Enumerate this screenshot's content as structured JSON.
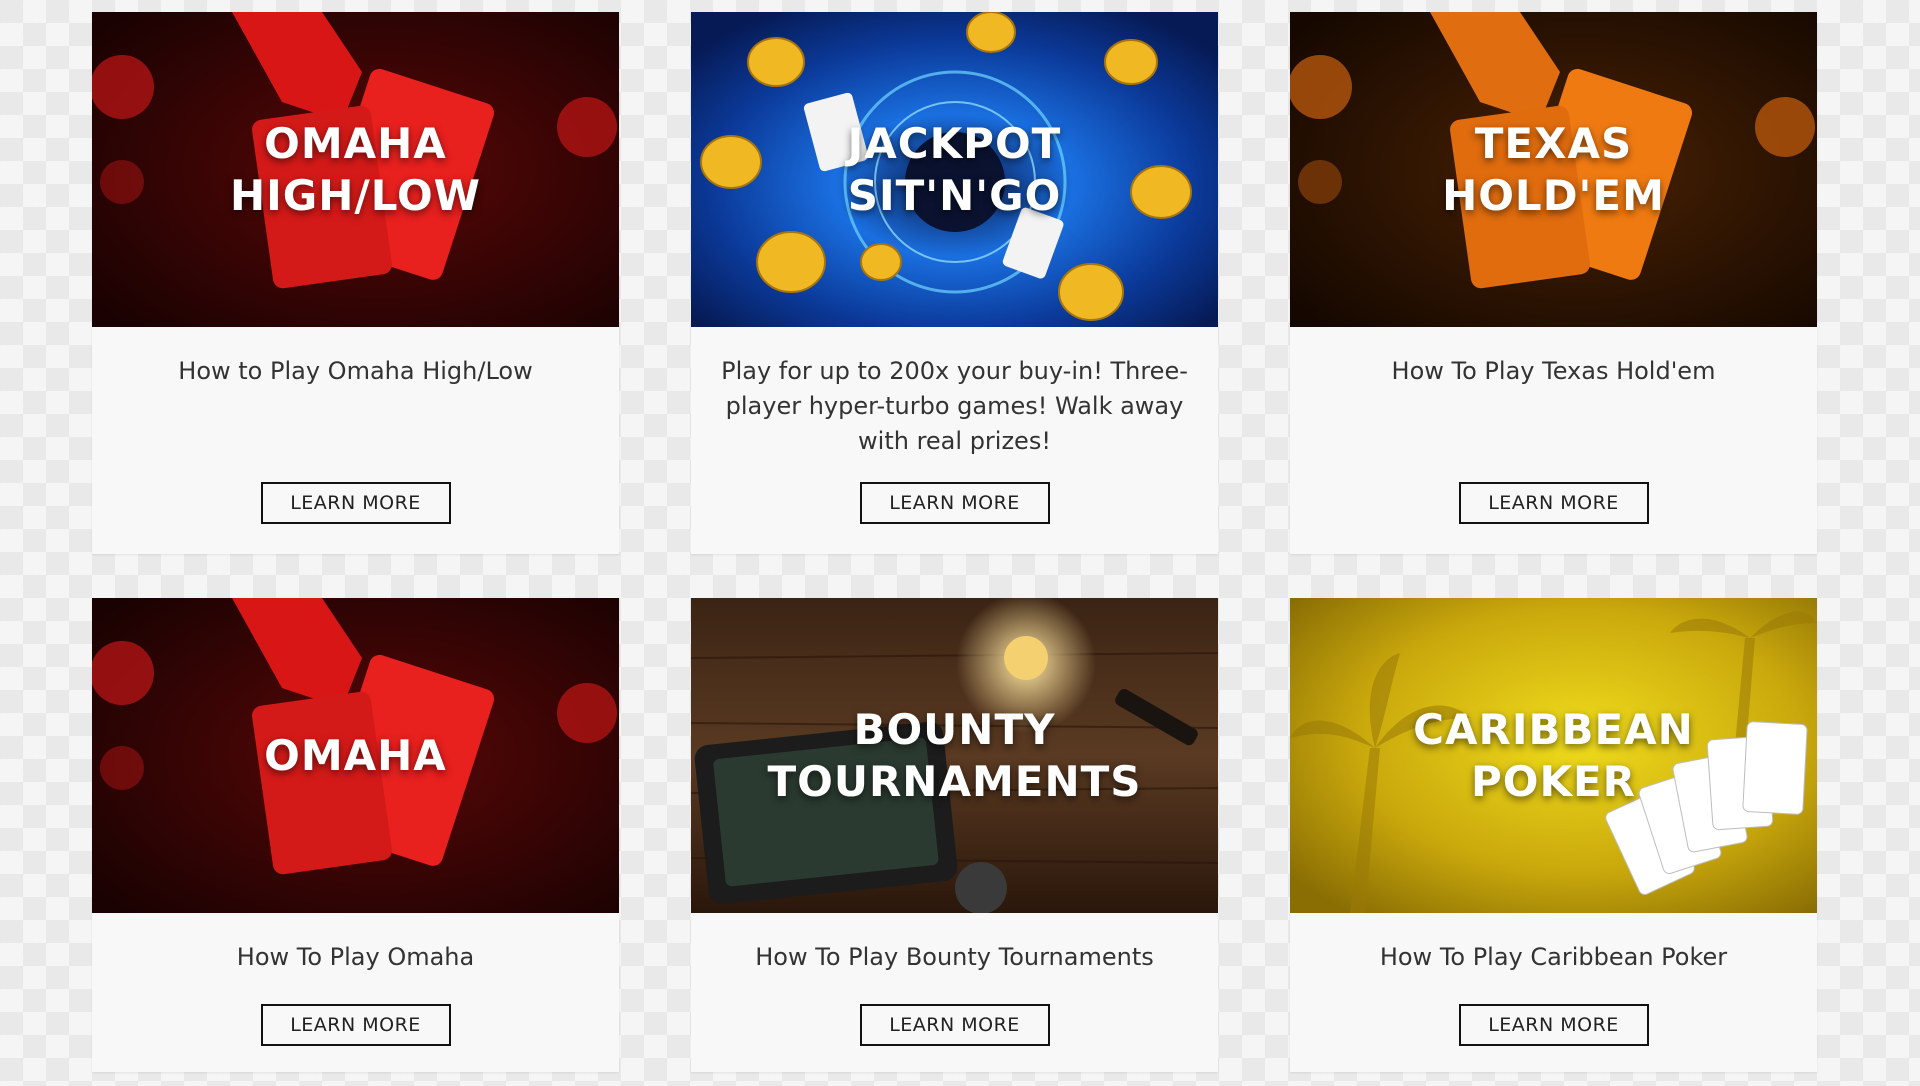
{
  "cards": [
    {
      "title_lines": [
        "OMAHA",
        "HIGH/LOW"
      ],
      "description": "How to Play Omaha High/Low",
      "button": "LEARN MORE",
      "theme": "red-hand-cards",
      "accent": "#e8201e"
    },
    {
      "title_lines": [
        "JACKPOT",
        "SIT'N'GO"
      ],
      "description": "Play for up to 200x your buy-in! Three-player hyper-turbo games! Walk away with real prizes!",
      "button": "LEARN MORE",
      "theme": "blue-portal-coins",
      "accent": "#1d6fd6"
    },
    {
      "title_lines": [
        "TEXAS",
        "HOLD'EM"
      ],
      "description": "How To Play Texas Hold'em",
      "button": "LEARN MORE",
      "theme": "orange-hand-cards",
      "accent": "#f07a12"
    },
    {
      "title_lines": [
        "OMAHA"
      ],
      "description": "How To Play Omaha",
      "button": "LEARN MORE",
      "theme": "red-hand-cards",
      "accent": "#e8201e"
    },
    {
      "title_lines": [
        "BOUNTY",
        "TOURNAMENTS"
      ],
      "description": "How To Play Bounty Tournaments",
      "button": "LEARN MORE",
      "theme": "wood-tablet",
      "accent": "#5a3a22"
    },
    {
      "title_lines": [
        "CARIBBEAN",
        "POKER"
      ],
      "description": "How To Play Caribbean Poker",
      "button": "LEARN MORE",
      "theme": "yellow-palms-cards",
      "accent": "#d8c010"
    }
  ]
}
